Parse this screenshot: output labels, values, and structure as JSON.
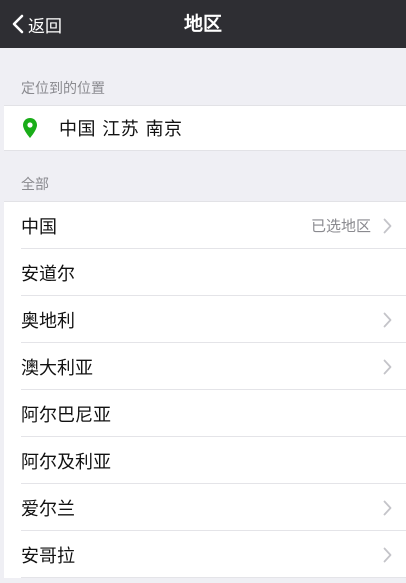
{
  "nav": {
    "back_label": "返回",
    "title": "地区"
  },
  "location_section": {
    "header": "定位到的位置",
    "value": "中国 江苏 南京",
    "icon": "location-pin-icon",
    "icon_color": "#1aad19"
  },
  "all_section": {
    "header": "全部",
    "items": [
      {
        "label": "中国",
        "note": "已选地区",
        "chevron": true
      },
      {
        "label": "安道尔",
        "note": "",
        "chevron": false
      },
      {
        "label": "奥地利",
        "note": "",
        "chevron": true
      },
      {
        "label": "澳大利亚",
        "note": "",
        "chevron": true
      },
      {
        "label": "阿尔巴尼亚",
        "note": "",
        "chevron": false
      },
      {
        "label": "阿尔及利亚",
        "note": "",
        "chevron": false
      },
      {
        "label": "爱尔兰",
        "note": "",
        "chevron": true
      },
      {
        "label": "安哥拉",
        "note": "",
        "chevron": true
      }
    ]
  },
  "colors": {
    "nav_background": "#2e2e33",
    "page_background": "#efeff4",
    "secondary_text": "#8a8a8f"
  }
}
